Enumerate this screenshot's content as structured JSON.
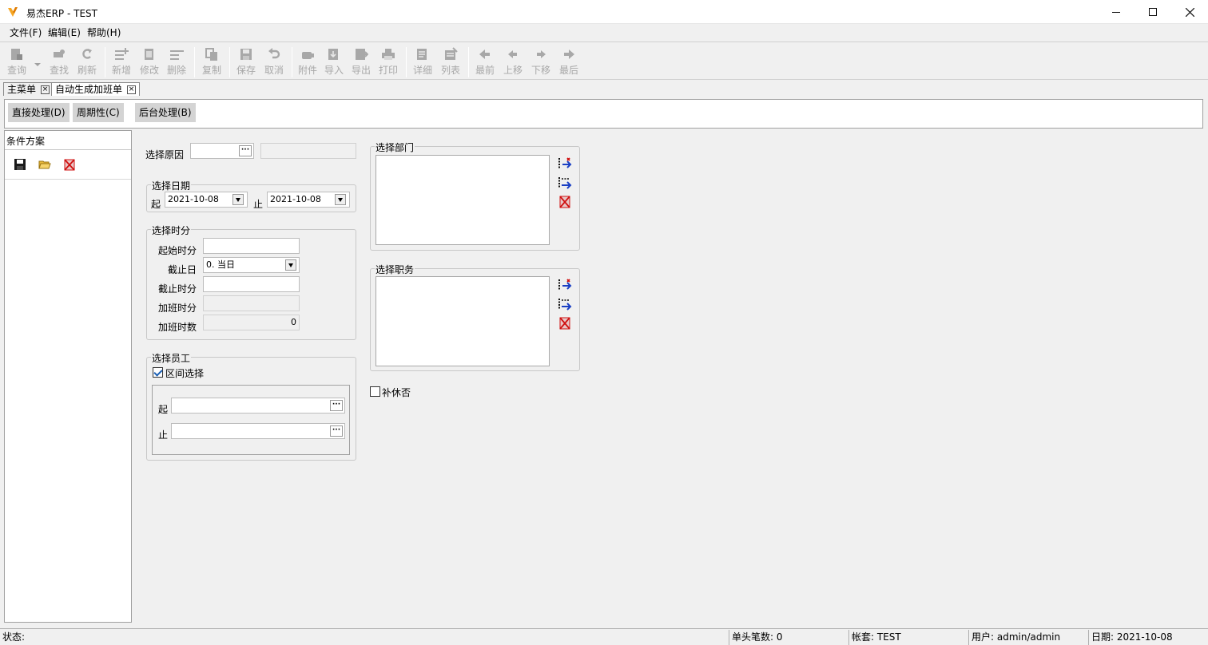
{
  "window": {
    "title": "易杰ERP - TEST",
    "minimize": "—",
    "maximize": "☐",
    "close": "✕"
  },
  "menu": [
    {
      "label": "文件(F)"
    },
    {
      "label": "编辑(E)"
    },
    {
      "label": "帮助(H)"
    }
  ],
  "toolbar": {
    "query": "查询",
    "find": "查找",
    "refresh": "刷新",
    "new": "新增",
    "edit": "修改",
    "delete": "删除",
    "copy": "复制",
    "save": "保存",
    "cancel": "取消",
    "attach": "附件",
    "import": "导入",
    "export": "导出",
    "print": "打印",
    "detail": "详细",
    "list": "列表",
    "first": "最前",
    "up": "上移",
    "down": "下移",
    "last": "最后"
  },
  "doc_tabs": [
    {
      "label": "主菜单"
    },
    {
      "label": "自动生成加班单"
    }
  ],
  "process_buttons": [
    {
      "label": "直接处理(D)"
    },
    {
      "label": "周期性(C)"
    },
    {
      "label": "后台处理(B)"
    }
  ],
  "left_panel": {
    "title": "条件方案"
  },
  "form": {
    "reason_label": "选择原因",
    "date_group": {
      "title": "选择日期",
      "from_label": "起",
      "from_value": "2021-10-08",
      "to_label": "止",
      "to_value": "2021-10-08"
    },
    "time_group": {
      "title": "选择时分",
      "start_label": "起始时分",
      "end_day_label": "截止日",
      "end_day_value": "0. 当日",
      "end_time_label": "截止时分",
      "ot_time_label": "加班时分",
      "ot_hours_label": "加班时数",
      "ot_hours_value": "0"
    },
    "employee_group": {
      "title": "选择员工",
      "range_label": "区间选择",
      "range_checked": true,
      "from_label": "起",
      "to_label": "止"
    },
    "dept_group": {
      "title": "选择部门"
    },
    "position_group": {
      "title": "选择职务"
    },
    "comp_leave_label": "补休否"
  },
  "status": {
    "status_label": "状态:",
    "count": "单头笔数: 0",
    "account": "帐套: TEST",
    "user": "用户: admin/admin",
    "date": "日期: 2021-10-08"
  },
  "colors": {
    "disabled_text": "#a8a8a8",
    "accent": "#1a5fb4",
    "logo": "#f5a623",
    "delete_red": "#d01010"
  }
}
